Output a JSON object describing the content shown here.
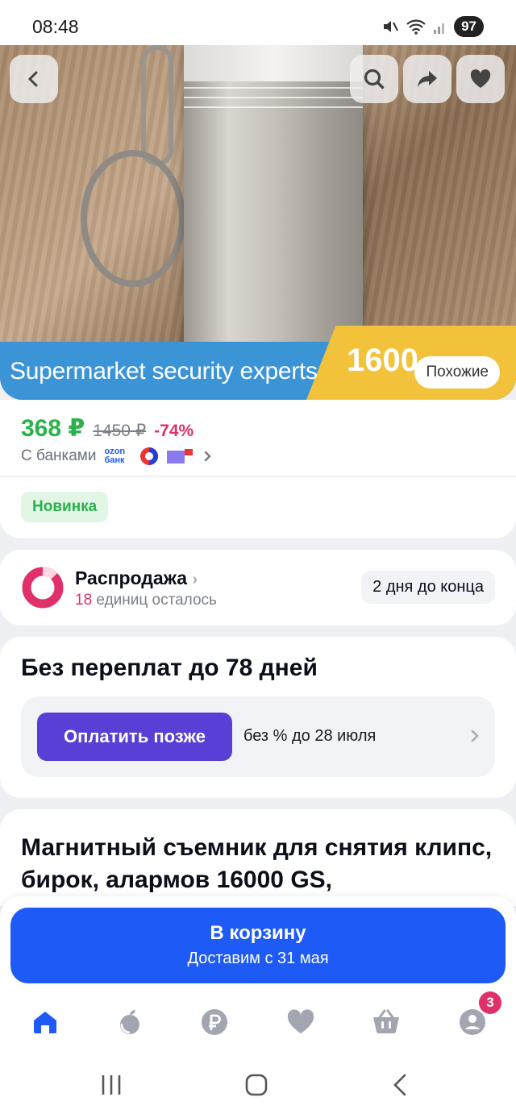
{
  "status_bar": {
    "time": "08:48",
    "battery": "97"
  },
  "hero": {
    "banner_text": "Supermarket security experts",
    "banner_number": "1600",
    "similar_label": "Похожие"
  },
  "price": {
    "current": "368 ₽",
    "old": "1450 ₽",
    "discount": "-74%",
    "banks_label": "С банками",
    "bank_logo_text": "ozon банк"
  },
  "badge_new": "Новинка",
  "sale": {
    "title": "Распродажа",
    "units_count": "18",
    "units_text": "единиц осталось",
    "deadline": "2 дня до конца"
  },
  "bnpl": {
    "title": "Без переплат до 78 дней",
    "button": "Оплатить позже",
    "note": "без % до 28 июля"
  },
  "product": {
    "title": "Магнитный съемник для снятия клипс, бирок, алармов 16000 GS,"
  },
  "cart": {
    "label": "В корзину",
    "delivery": "Доставим с 31 мая"
  },
  "tabbar": {
    "items": [
      "home-icon",
      "fresh-icon",
      "ruble-icon",
      "favorites-icon",
      "cart-icon",
      "profile-icon"
    ],
    "profile_badge": "3"
  },
  "colors": {
    "accent": "#1e5bf6",
    "price_green": "#2bb24c",
    "discount_pink": "#e0306a",
    "bnpl_purple": "#5a3fd6"
  }
}
